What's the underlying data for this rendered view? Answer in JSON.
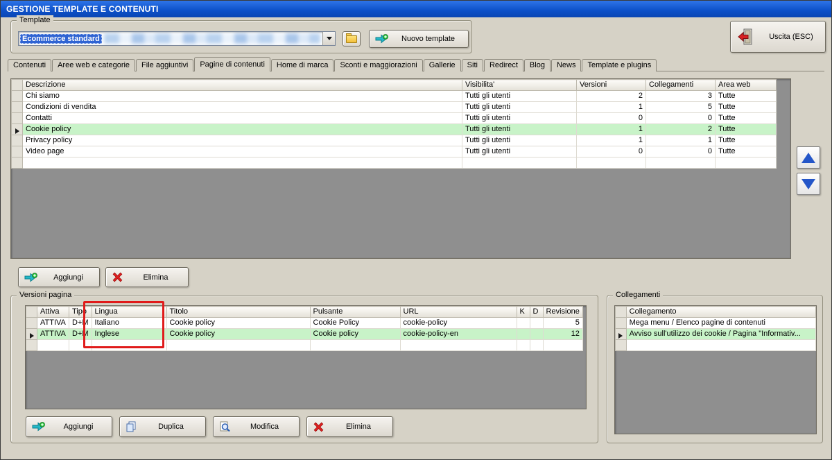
{
  "window": {
    "title": "GESTIONE TEMPLATE E CONTENUTI"
  },
  "template_section": {
    "group_label": "Template",
    "combo_value": "Ecommerce standard",
    "new_template_button": "Nuovo template"
  },
  "exit_button_label": "Uscita (ESC)",
  "tabs": {
    "items": [
      "Contenuti",
      "Aree web e categorie",
      "File aggiuntivi",
      "Pagine di contenuti",
      "Home di marca",
      "Sconti e maggiorazioni",
      "Gallerie",
      "Siti",
      "Redirect",
      "Blog",
      "News",
      "Template e plugins"
    ],
    "active": "Pagine di contenuti"
  },
  "pages_grid": {
    "headers": {
      "descrizione": "Descrizione",
      "visibilita": "Visibilita'",
      "versioni": "Versioni",
      "collegamenti": "Collegamenti",
      "area_web": "Area web"
    },
    "rows": [
      {
        "descrizione": "Chi siamo",
        "visibilita": "Tutti gli utenti",
        "versioni": "2",
        "collegamenti": "3",
        "area_web": "Tutte"
      },
      {
        "descrizione": "Condizioni di vendita",
        "visibilita": "Tutti gli utenti",
        "versioni": "1",
        "collegamenti": "5",
        "area_web": "Tutte"
      },
      {
        "descrizione": "Contatti",
        "visibilita": "Tutti gli utenti",
        "versioni": "0",
        "collegamenti": "0",
        "area_web": "Tutte"
      },
      {
        "descrizione": "Cookie policy",
        "visibilita": "Tutti gli utenti",
        "versioni": "1",
        "collegamenti": "2",
        "area_web": "Tutte"
      },
      {
        "descrizione": "Privacy policy",
        "visibilita": "Tutti gli utenti",
        "versioni": "1",
        "collegamenti": "1",
        "area_web": "Tutte"
      },
      {
        "descrizione": "Video page",
        "visibilita": "Tutti gli utenti",
        "versioni": "0",
        "collegamenti": "0",
        "area_web": "Tutte"
      }
    ]
  },
  "page_actions": {
    "add": "Aggiungi",
    "delete": "Elimina"
  },
  "versions_section": {
    "group_label": "Versioni pagina",
    "headers": {
      "attiva": "Attiva",
      "tipo": "Tipo",
      "lingua": "Lingua",
      "titolo": "Titolo",
      "pulsante": "Pulsante",
      "url": "URL",
      "k": "K",
      "d": "D",
      "revisione": "Revisione"
    },
    "rows": [
      {
        "attiva": "ATTIVA",
        "tipo": "D+M",
        "lingua": "Italiano",
        "titolo": "Cookie policy",
        "pulsante": "Cookie Policy",
        "url": "cookie-policy",
        "k": "",
        "d": "",
        "revisione": "5"
      },
      {
        "attiva": "ATTIVA",
        "tipo": "D+M",
        "lingua": "Inglese",
        "titolo": "Cookie policy",
        "pulsante": "Cookie policy",
        "url": "cookie-policy-en",
        "k": "",
        "d": "",
        "revisione": "12"
      }
    ],
    "buttons": {
      "add": "Aggiungi",
      "duplicate": "Duplica",
      "modify": "Modifica",
      "delete": "Elimina"
    }
  },
  "links_section": {
    "group_label": "Collegamenti",
    "header": "Collegamento",
    "rows": [
      "Mega menu / Elenco pagine di contenuti",
      "Avviso sull'utilizzo dei cookie / Pagina \"Informativ..."
    ]
  }
}
